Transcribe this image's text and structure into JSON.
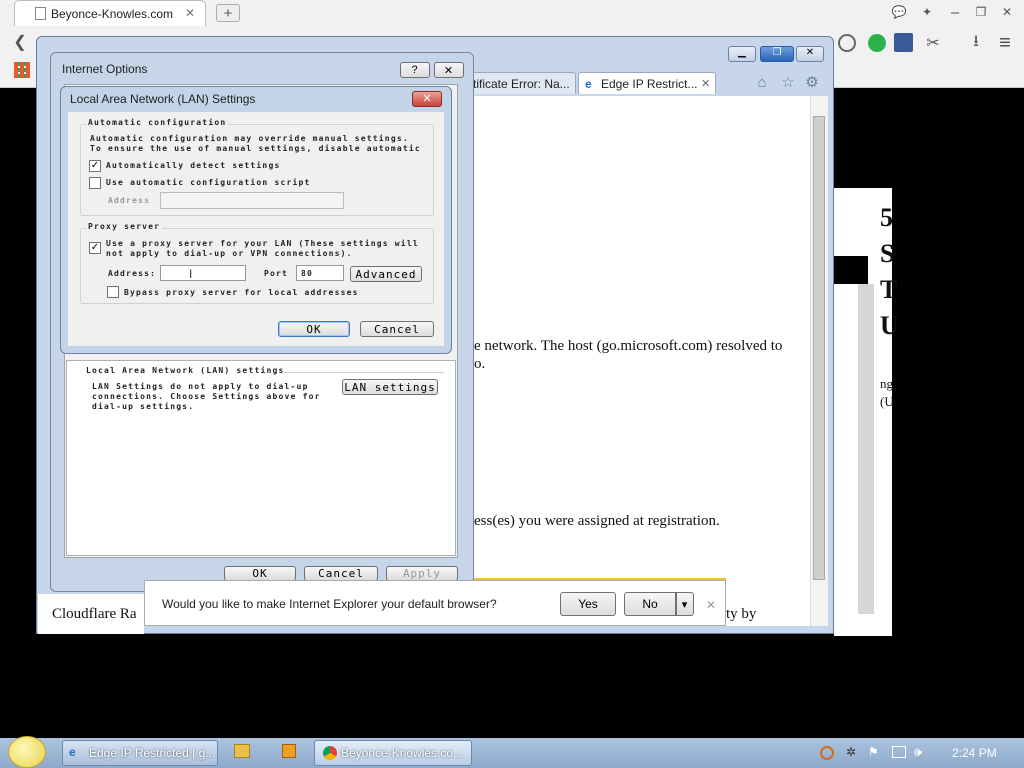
{
  "chrome": {
    "tab_title": "Beyonce-Knowles.com",
    "new_tab": "+",
    "back": "❮",
    "menu": "≡"
  },
  "ie": {
    "tabs": [
      {
        "label": "rtificate Error: Na..."
      },
      {
        "label": "Edge IP Restrict..."
      }
    ],
    "tab_close": "✕",
    "body_line1": "e network. The host (go.microsoft.com) resolved to",
    "body_line2": "o.",
    "body_line3": "ess(es) you were assigned at registration.",
    "footer_left": "Cloudflare Ra",
    "footer_right": "ty by"
  },
  "right_page": {
    "chars": [
      "5",
      "S",
      "T",
      "U"
    ],
    "small1": "ng",
    "small2": "(U"
  },
  "internet_options": {
    "title": "Internet Options",
    "help": "?",
    "close": "✕",
    "lan_section_label": "Local Area Network (LAN) settings",
    "lan_desc1": "LAN Settings do not apply to dial-up",
    "lan_desc2": "connections. Choose Settings above for",
    "lan_desc3": "dial-up settings.",
    "lan_settings_btn": "LAN settings",
    "ok": "OK",
    "cancel": "Cancel",
    "apply": "Apply"
  },
  "lan_dialog": {
    "title": "Local Area Network (LAN) Settings",
    "close": "✕",
    "auto_config_group": "Automatic configuration",
    "auto_desc1": "Automatic configuration may override manual settings.",
    "auto_desc2": "To ensure the use of manual settings, disable automatic",
    "auto_detect_label": "Automatically detect settings",
    "auto_script_label": "Use automatic configuration script",
    "address_label": "Address",
    "proxy_group": "Proxy server",
    "proxy_label1": "Use a proxy server for your LAN (These settings will",
    "proxy_label2": "not apply to dial-up or VPN connections).",
    "proxy_address_label": "Address:",
    "port_label": "Port",
    "port_value": "80",
    "advanced": "Advanced",
    "bypass_label": "Bypass proxy server for local addresses",
    "ok": "OK",
    "cancel": "Cancel",
    "auto_detect_checked": true,
    "auto_script_checked": false,
    "proxy_checked": true,
    "bypass_checked": false
  },
  "notification": {
    "text": "Would you like to make Internet Explorer your default browser?",
    "yes": "Yes",
    "no": "No",
    "dropdown": "▾",
    "close": "✕"
  },
  "taskbar": {
    "items": [
      {
        "label": "Edge IP Restricted | g..."
      },
      {
        "label": "Beyonce-Knowles.co..."
      }
    ],
    "clock": "2:24 PM"
  },
  "colors": {
    "dialog_frame": "#c7d5e8",
    "notify_accent": "#f2c12e",
    "close_red": "#c9423a",
    "taskbar": "#9db6d4"
  }
}
